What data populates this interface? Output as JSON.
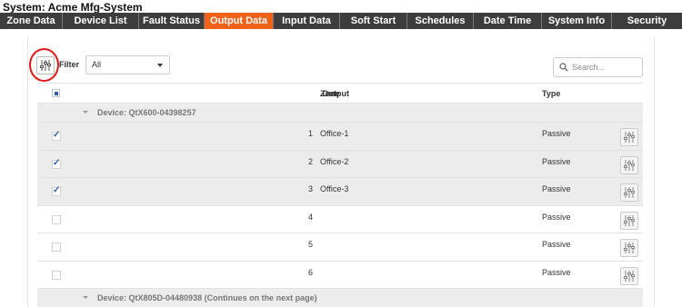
{
  "system": {
    "title": "System: Acme Mfg-System"
  },
  "tabs": [
    {
      "label": "Zone Data",
      "active": false
    },
    {
      "label": "Device List",
      "active": false
    },
    {
      "label": "Fault Status",
      "active": false
    },
    {
      "label": "Output Data",
      "active": true
    },
    {
      "label": "Input Data",
      "active": false
    },
    {
      "label": "Soft Start",
      "active": false
    },
    {
      "label": "Schedules",
      "active": false
    },
    {
      "label": "Date Time",
      "active": false
    },
    {
      "label": "System Info",
      "active": false
    },
    {
      "label": "Security",
      "active": false
    }
  ],
  "filter": {
    "label": "Filter",
    "selected": "All",
    "icon": "sliders-icon"
  },
  "search": {
    "placeholder": "Search...",
    "value": ""
  },
  "table": {
    "headers": {
      "output": "Output",
      "zone": "Zone",
      "type": "Type"
    },
    "groups": [
      {
        "label": "Device: QtX600-04398257",
        "rows": [
          {
            "checked": true,
            "output": "1",
            "zone": "Office-1",
            "type": "Passive"
          },
          {
            "checked": true,
            "output": "2",
            "zone": "Office-2",
            "type": "Passive"
          },
          {
            "checked": true,
            "output": "3",
            "zone": "Office-3",
            "type": "Passive"
          },
          {
            "checked": false,
            "output": "4",
            "zone": "",
            "type": "Passive"
          },
          {
            "checked": false,
            "output": "5",
            "zone": "",
            "type": "Passive"
          },
          {
            "checked": false,
            "output": "6",
            "zone": "",
            "type": "Passive"
          }
        ]
      },
      {
        "label": "Device: QtX805D-04480938 (Continues on the next page)",
        "rows": []
      }
    ]
  },
  "colors": {
    "accent": "#f0611a",
    "tab_bar": "#3d3d3d",
    "highlight_circle": "#e01818",
    "check": "#2e5fb3"
  }
}
